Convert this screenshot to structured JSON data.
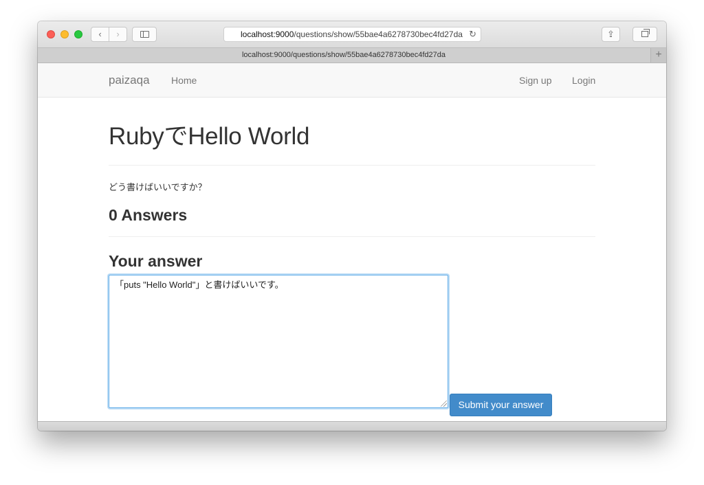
{
  "browser": {
    "url_host": "localhost:9000",
    "url_path": "/questions/show/55bae4a6278730bec4fd27da",
    "tab_title": "localhost:9000/questions/show/55bae4a6278730bec4fd27da",
    "back_glyph": "‹",
    "forward_glyph": "›",
    "reload_glyph": "↻",
    "share_glyph": "⇪",
    "newtab_glyph": "+"
  },
  "navbar": {
    "brand": "paizaqa",
    "home": "Home",
    "sign_up": "Sign up",
    "login": "Login"
  },
  "question": {
    "title": "RubyでHello World",
    "body": "どう書けばいいですか？"
  },
  "answers": {
    "count_label": "0 Answers"
  },
  "answer_form": {
    "heading": "Your answer",
    "textarea_value": "「puts \"Hello World\"」と書けばいいです。\n",
    "submit_label": "Submit your answer"
  },
  "colors": {
    "primary": "#428bca",
    "focus_ring": "#66afe9",
    "navbar_bg": "#f8f8f8"
  },
  "icons": {
    "sidebar": "sidebar-icon",
    "share": "share-icon",
    "tabs": "tabs-overview-icon",
    "reload": "reload-icon"
  }
}
